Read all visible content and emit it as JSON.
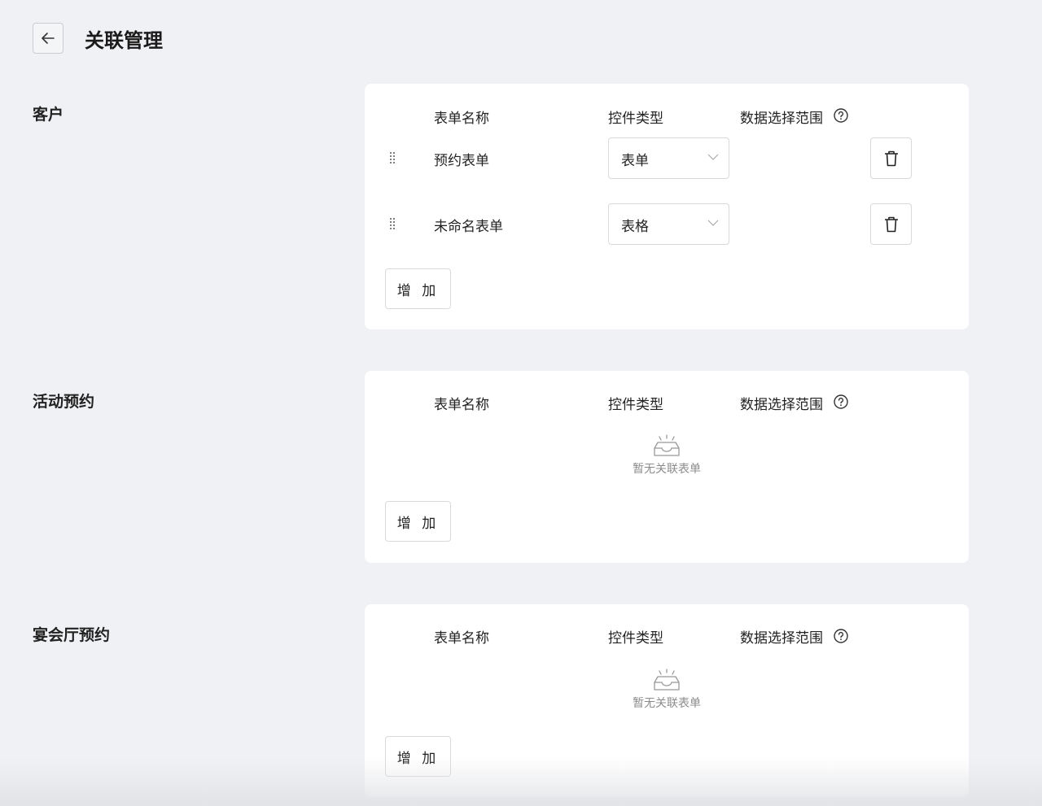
{
  "header": {
    "title": "关联管理",
    "back_icon": "arrow-left-icon"
  },
  "columns": {
    "form_name": "表单名称",
    "control_type": "控件类型",
    "data_range": "数据选择范围"
  },
  "sections": [
    {
      "label": "客户",
      "rows": [
        {
          "name": "预约表单",
          "control": "表单"
        },
        {
          "name": "未命名表单",
          "control": "表格"
        }
      ],
      "add_label": "增 加"
    },
    {
      "label": "活动预约",
      "empty_text": "暂无关联表单",
      "add_label": "增 加"
    },
    {
      "label": "宴会厅预约",
      "empty_text": "暂无关联表单",
      "add_label": "增 加"
    }
  ]
}
